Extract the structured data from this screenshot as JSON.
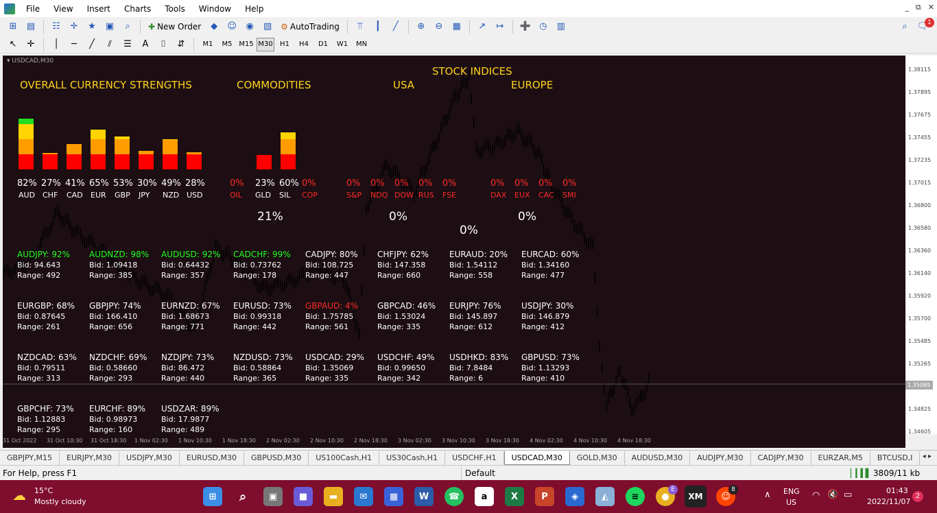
{
  "menu": [
    "File",
    "View",
    "Insert",
    "Charts",
    "Tools",
    "Window",
    "Help"
  ],
  "window_controls": [
    "_",
    "⧉",
    "✕"
  ],
  "toolbar": {
    "new_order": "New Order",
    "auto_trading": "AutoTrading",
    "notif_count": "1"
  },
  "timeframes": [
    "M1",
    "M5",
    "M15",
    "M30",
    "H1",
    "H4",
    "D1",
    "W1",
    "MN"
  ],
  "active_timeframe": "M30",
  "chart": {
    "label": "USDCAD,M30",
    "titles": {
      "overall": "OVERALL CURRENCY STRENGTHS",
      "commodities": "COMMODITIES",
      "stock": "STOCK INDICES",
      "usa": "USA",
      "europe": "EUROPE"
    },
    "currencies": [
      {
        "name": "AUD",
        "pct": "82%",
        "value": 82
      },
      {
        "name": "CHF",
        "pct": "27%",
        "value": 27
      },
      {
        "name": "CAD",
        "pct": "41%",
        "value": 41
      },
      {
        "name": "EUR",
        "pct": "65%",
        "value": 65
      },
      {
        "name": "GBP",
        "pct": "53%",
        "value": 53
      },
      {
        "name": "JPY",
        "pct": "30%",
        "value": 30
      },
      {
        "name": "NZD",
        "pct": "49%",
        "value": 49
      },
      {
        "name": "USD",
        "pct": "28%",
        "value": 28
      }
    ],
    "commodities": [
      {
        "name": "OIL",
        "pct": "0%",
        "value": 0,
        "red": true
      },
      {
        "name": "GLD",
        "pct": "23%",
        "value": 23,
        "red": false
      },
      {
        "name": "SIL",
        "pct": "60%",
        "value": 60,
        "red": false
      },
      {
        "name": "COP",
        "pct": "0%",
        "value": 0,
        "red": true
      }
    ],
    "usa": [
      {
        "name": "S&P",
        "pct": "0%"
      },
      {
        "name": "NDQ",
        "pct": "0%"
      },
      {
        "name": "DOW",
        "pct": "0%"
      },
      {
        "name": "RUS",
        "pct": "0%"
      },
      {
        "name": "FSE",
        "pct": "0%"
      }
    ],
    "europe": [
      {
        "name": "DAX",
        "pct": "0%"
      },
      {
        "name": "EUX",
        "pct": "0%"
      },
      {
        "name": "CAC",
        "pct": "0%"
      },
      {
        "name": "SMI",
        "pct": "0%"
      }
    ],
    "totals": {
      "commodities": "21%",
      "usa": "0%",
      "stock": "0%",
      "europe": "0%"
    },
    "pairs": [
      {
        "name": "AUDJPY: 92%",
        "bid": "Bid: 94.643",
        "range": "Range: 492",
        "color": "green"
      },
      {
        "name": "AUDNZD: 98%",
        "bid": "Bid: 1.09418",
        "range": "Range: 385",
        "color": "green"
      },
      {
        "name": "AUDUSD: 92%",
        "bid": "Bid: 0.64432",
        "range": "Range: 357",
        "color": "green"
      },
      {
        "name": "CADCHF: 99%",
        "bid": "Bid: 0.73762",
        "range": "Range: 178",
        "color": "green"
      },
      {
        "name": "CADJPY: 80%",
        "bid": "Bid: 108.725",
        "range": "Range: 447",
        "color": "white"
      },
      {
        "name": "CHFJPY: 62%",
        "bid": "Bid: 147.358",
        "range": "Range: 660",
        "color": "white"
      },
      {
        "name": "EURAUD: 20%",
        "bid": "Bid: 1.54112",
        "range": "Range: 558",
        "color": "white"
      },
      {
        "name": "EURCAD: 60%",
        "bid": "Bid: 1.34160",
        "range": "Range: 477",
        "color": "white"
      },
      {
        "name": "EURGBP: 68%",
        "bid": "Bid: 0.87645",
        "range": "Range: 261",
        "color": "white"
      },
      {
        "name": "GBPJPY: 74%",
        "bid": "Bid: 166.410",
        "range": "Range: 656",
        "color": "white"
      },
      {
        "name": "EURNZD: 67%",
        "bid": "Bid: 1.68673",
        "range": "Range: 771",
        "color": "white"
      },
      {
        "name": "EURUSD: 73%",
        "bid": "Bid: 0.99318",
        "range": "Range: 442",
        "color": "white"
      },
      {
        "name": "GBPAUD: 4%",
        "bid": "Bid: 1.75785",
        "range": "Range: 561",
        "color": "red"
      },
      {
        "name": "GBPCAD: 46%",
        "bid": "Bid: 1.53024",
        "range": "Range: 335",
        "color": "white"
      },
      {
        "name": "EURJPY: 76%",
        "bid": "Bid: 145.897",
        "range": "Range: 612",
        "color": "white"
      },
      {
        "name": "USDJPY: 30%",
        "bid": "Bid: 146.879",
        "range": "Range: 412",
        "color": "white"
      },
      {
        "name": "NZDCAD: 63%",
        "bid": "Bid: 0.79511",
        "range": "Range: 313",
        "color": "white"
      },
      {
        "name": "NZDCHF: 69%",
        "bid": "Bid: 0.58660",
        "range": "Range: 293",
        "color": "white"
      },
      {
        "name": "NZDJPY: 73%",
        "bid": "Bid: 86.472",
        "range": "Range: 440",
        "color": "white"
      },
      {
        "name": "NZDUSD: 73%",
        "bid": "Bid: 0.58864",
        "range": "Range: 365",
        "color": "white"
      },
      {
        "name": "USDCAD: 29%",
        "bid": "Bid: 1.35069",
        "range": "Range: 335",
        "color": "white"
      },
      {
        "name": "USDCHF: 49%",
        "bid": "Bid: 0.99650",
        "range": "Range: 342",
        "color": "white"
      },
      {
        "name": "USDHKD: 83%",
        "bid": "Bid: 7.8484",
        "range": "Range: 6",
        "color": "white"
      },
      {
        "name": "GBPUSD: 73%",
        "bid": "Bid: 1.13293",
        "range": "Range: 410",
        "color": "white"
      },
      {
        "name": "GBPCHF: 73%",
        "bid": "Bid: 1.12883",
        "range": "Range: 295",
        "color": "white"
      },
      {
        "name": "EURCHF: 89%",
        "bid": "Bid: 0.98973",
        "range": "Range: 160",
        "color": "white"
      },
      {
        "name": "USDZAR: 89%",
        "bid": "Bid: 17.9877",
        "range": "Range: 489",
        "color": "white"
      }
    ],
    "price_labels": [
      "1.38115",
      "1.37895",
      "1.37675",
      "1.37455",
      "1.37235",
      "1.37015",
      "1.36800",
      "1.36580",
      "1.36360",
      "1.36140",
      "1.35920",
      "1.35700",
      "1.35485",
      "1.35265",
      "1.35069",
      "1.34825",
      "1.34605"
    ],
    "current_price": "1.35069",
    "time_labels": [
      "31 Oct 2022",
      "31 Oct 10:30",
      "31 Oct 18:30",
      "1 Nov 02:30",
      "1 Nov 10:30",
      "1 Nov 18:30",
      "2 Nov 02:30",
      "2 Nov 10:30",
      "2 Nov 18:30",
      "3 Nov 02:30",
      "3 Nov 10:30",
      "3 Nov 18:30",
      "4 Nov 02:30",
      "4 Nov 10:30",
      "4 Nov 18:30"
    ],
    "colors": {
      "bg": "#1c0e12",
      "title": "#ffd21e",
      "green": "#22ff22",
      "red": "#ff2a2a",
      "bar_red": "#ff0000",
      "bar_orange": "#ff9c00",
      "bar_yellow": "#ffd400",
      "bar_green": "#22dd22"
    }
  },
  "tabs": [
    "GBPJPY,M15",
    "EURJPY,M30",
    "USDJPY,M30",
    "EURUSD,M30",
    "GBPUSD,M30",
    "US100Cash,H1",
    "US30Cash,H1",
    "USDCHF,H1",
    "USDCAD,M30",
    "GOLD,M30",
    "AUDUSD,M30",
    "AUDJPY,M30",
    "CADJPY,M30",
    "EURZAR,M5",
    "BTCUSD,I"
  ],
  "active_tab": "USDCAD,M30",
  "status": {
    "help": "For Help, press F1",
    "profile": "Default",
    "traffic": "3809/11 kb"
  },
  "taskbar": {
    "temp": "15°C",
    "weather": "Mostly cloudy",
    "lang1": "ENG",
    "lang2": "US",
    "time": "01:43",
    "date": "2022/11/07",
    "notif": "2",
    "chrome_badge": "E",
    "reddit_badge": "8"
  }
}
